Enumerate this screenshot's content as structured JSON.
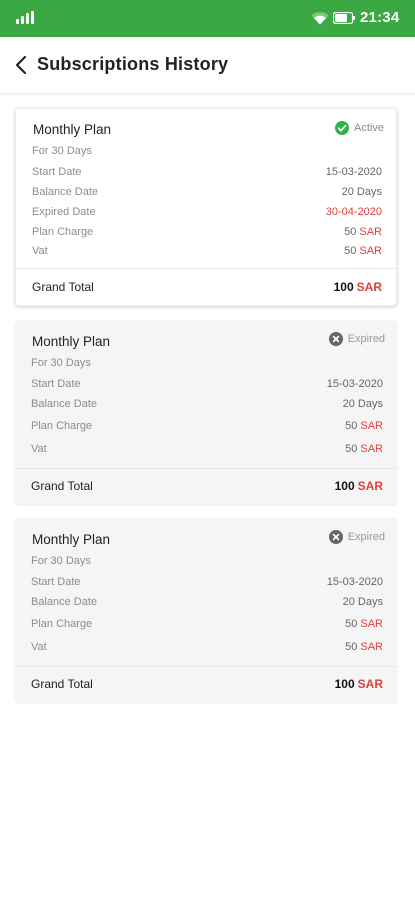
{
  "status_bar": {
    "time": "21:34"
  },
  "header": {
    "title": "Subscriptions History"
  },
  "subscriptions": [
    {
      "plan": "Monthly Plan",
      "status": "Active",
      "duration": "For 30 Days",
      "start_date_label": "Start Date",
      "start_date": "15-03-2020",
      "balance_label": "Balance Date",
      "balance": "20 Days",
      "expired_label": "Expired Date",
      "expired_date": "30-04-2020",
      "charge_label": "Plan Charge",
      "charge": "50",
      "vat_label": "Vat",
      "vat": "50",
      "total_label": "Grand Total",
      "total": "100",
      "currency": "SAR"
    },
    {
      "plan": "Monthly Plan",
      "status": "Expired",
      "duration": "For 30 Days",
      "start_date_label": "Start Date",
      "start_date": "15-03-2020",
      "balance_label": "Balance Date",
      "balance": "20 Days",
      "charge_label": "Plan Charge",
      "charge": "50",
      "vat_label": "Vat",
      "vat": "50",
      "total_label": "Grand Total",
      "total": "100",
      "currency": "SAR"
    },
    {
      "plan": "Monthly Plan",
      "status": "Expired",
      "duration": "For 30 Days",
      "start_date_label": "Start Date",
      "start_date": "15-03-2020",
      "balance_label": "Balance Date",
      "balance": "20 Days",
      "charge_label": "Plan Charge",
      "charge": "50",
      "vat_label": "Vat",
      "vat": "50",
      "total_label": "Grand Total",
      "total": "100",
      "currency": "SAR"
    }
  ],
  "colors": {
    "status_bar": "#3aa843",
    "active_icon": "#2eb24a",
    "expired_icon": "#666666",
    "accent_red": "#e0403c"
  },
  "icons": {
    "signal": "signal-icon",
    "wifi": "wifi-icon",
    "battery": "battery-icon",
    "back": "chevron-left-icon",
    "active": "check-circle-icon",
    "expired": "x-circle-icon"
  }
}
